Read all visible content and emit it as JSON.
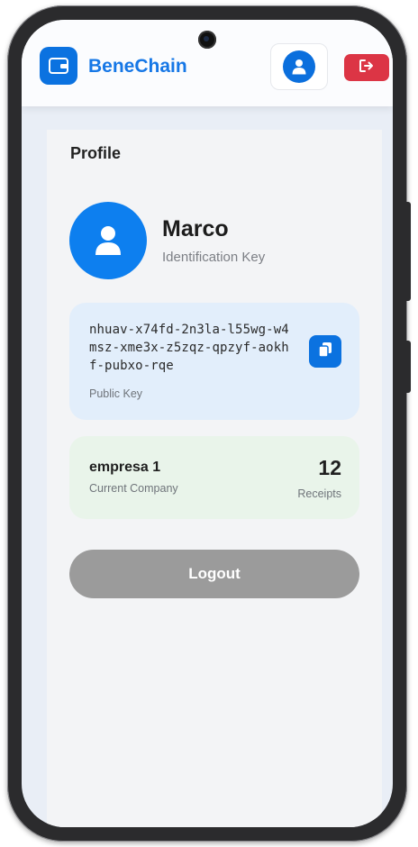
{
  "header": {
    "brand": "BeneChain",
    "icons": {
      "logo": "wallet-icon",
      "profile": "user-icon",
      "logout": "sign-out-icon"
    }
  },
  "profile": {
    "title": "Profile",
    "name": "Marco",
    "subtitle": "Identification Key",
    "public_key": "nhuav-x74fd-2n3la-l55wg-w4msz-xme3x-z5zqz-qpzyf-aokhf-pubxo-rqe",
    "public_key_label": "Public Key",
    "copy_icon": "copy-icon"
  },
  "company": {
    "name": "empresa 1",
    "label": "Current Company",
    "receipts_count": "12",
    "receipts_label": "Receipts"
  },
  "actions": {
    "logout_label": "Logout"
  },
  "colors": {
    "primary": "#0b72e0",
    "danger": "#dc3545",
    "key_card_bg": "#e2eefb",
    "company_card_bg": "#e9f4ea",
    "logout_button_bg": "#9b9b9b"
  }
}
